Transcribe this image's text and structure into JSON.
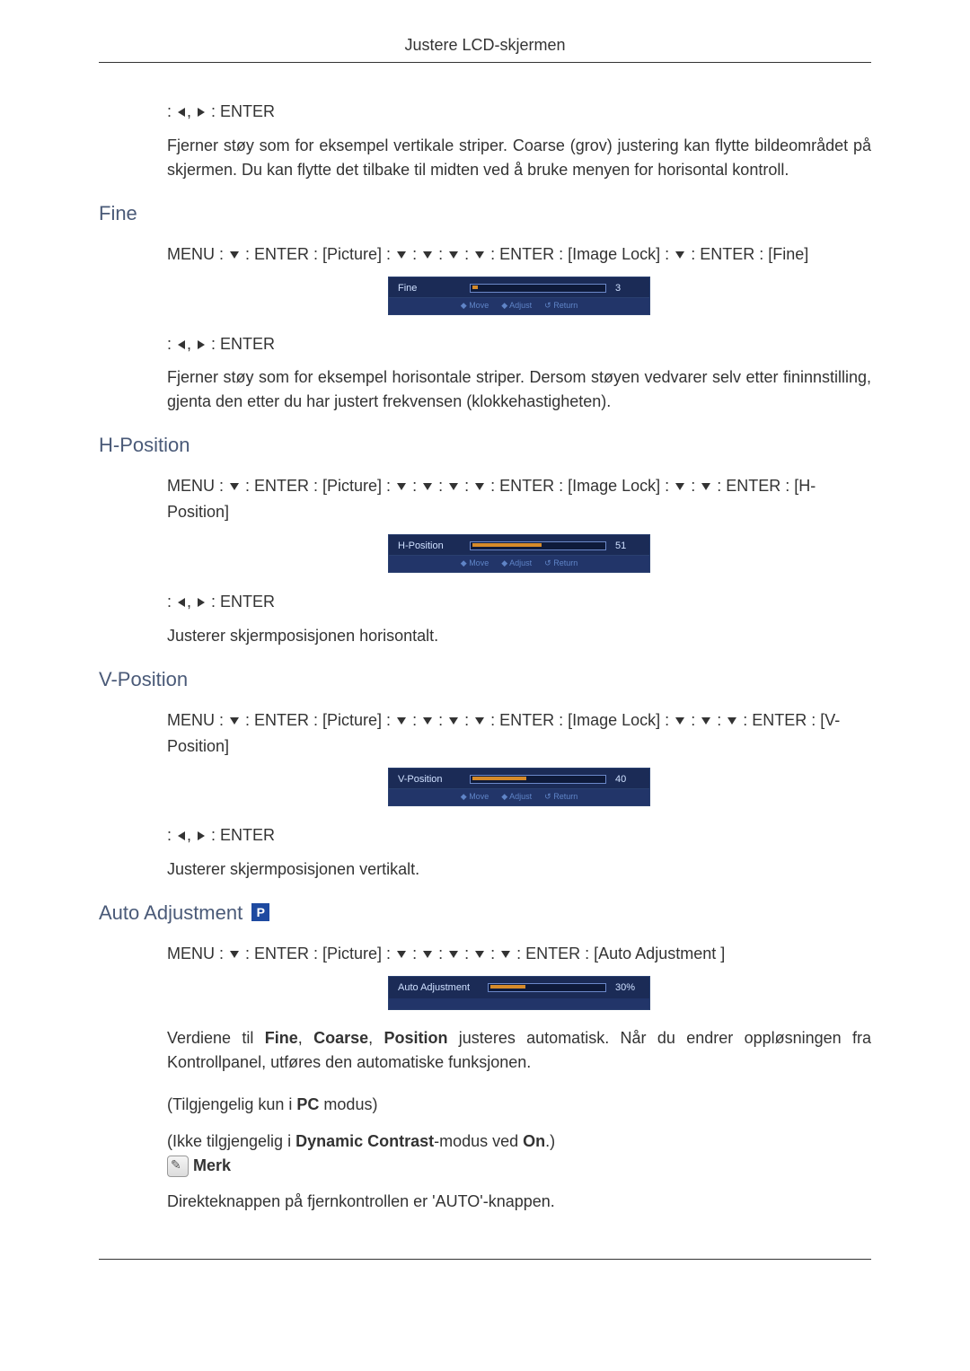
{
  "header": {
    "title": "Justere LCD-skjermen"
  },
  "top": {
    "nav_b": " : ENTER",
    "desc": "Fjerner støy som for eksempel vertikale striper. Coarse (grov) justering kan flytte bildeområdet på skjermen. Du kan flytte det tilbake til midten ved å bruke menyen for horisontal kontroll."
  },
  "fine": {
    "title": "Fine",
    "path1_a": "MENU  :  ",
    "path1_b": "  :  ENTER  :  [Picture]  :  ",
    "path1_c": "  :  ",
    "path1_d": "  :  ",
    "path1_e": "  :  ",
    "path1_f": "  :  ENTER  :  [Image Lock]  :  ",
    "path1_g": "  :  ENTER  : [Fine]",
    "osd_label": "Fine",
    "osd_value": "3",
    "hint_move": "◆ Move",
    "hint_adjust": "◆ Adjust",
    "hint_return": "↺ Return",
    "nav_b": " : ENTER",
    "desc": "Fjerner støy som for eksempel horisontale striper. Dersom støyen vedvarer selv etter fininnstilling, gjenta den etter du har justert frekvensen (klokkehastigheten)."
  },
  "hpos": {
    "title": "H-Position",
    "path1_a": "MENU  :  ",
    "path1_b": "  :  ENTER  :  [Picture]  :  ",
    "path1_c": "  :  ",
    "path1_d": "  :  ",
    "path1_e": "  :  ",
    "path1_f": "  :  ENTER  :  [Image Lock]  :  ",
    "path1_g": "  :  ",
    "path1_h": " :  ENTER  : [H-Position]",
    "osd_label": "H-Position",
    "osd_value": "51",
    "nav_b": " : ENTER",
    "desc": "Justerer skjermposisjonen horisontalt."
  },
  "vpos": {
    "title": "V-Position",
    "path1_a": "MENU  :  ",
    "path1_b": "  :  ENTER  :  [Picture]  :  ",
    "path1_c": "  :  ",
    "path1_d": "  :  ",
    "path1_e": "  :  ",
    "path1_f": "  :  ENTER  :  [Image Lock]  :  ",
    "path1_g": "  :  ",
    "path1_h": " :  ",
    "path1_i": "  : ENTER  : [V-Position]",
    "osd_label": "V-Position",
    "osd_value": "40",
    "nav_b": " : ENTER",
    "desc": "Justerer skjermposisjonen vertikalt."
  },
  "auto": {
    "title": "Auto Adjustment",
    "badge": "P",
    "path1_a": "MENU  :  ",
    "path1_b": "  : ENTER  : [Picture]  :     ",
    "path1_c": "  :  ",
    "path1_d": "  :  ",
    "path1_e": "  :  ",
    "path1_f": "  :  ",
    "path1_g": "  : ENTER  : [Auto Adjustment ]",
    "osd_label": "Auto Adjustment",
    "osd_value": "30%",
    "desc1a": "Verdiene til ",
    "desc1b": "Fine",
    "desc1c": ", ",
    "desc1d": "Coarse",
    "desc1e": ", ",
    "desc1f": "Position",
    "desc1g": " justeres automatisk. Når du endrer oppløsningen fra Kontrollpanel, utføres den automatiske funksjonen.",
    "desc2a": "(Tilgjengelig kun i ",
    "desc2b": "PC",
    "desc2c": " modus)",
    "desc3a": "(Ikke tilgjengelig i ",
    "desc3b": "Dynamic Contrast",
    "desc3c": "-modus ved ",
    "desc3d": "On",
    "desc3e": ".)",
    "merk": " Merk",
    "desc4": "Direkteknappen på fjernkontrollen er 'AUTO'-knappen."
  }
}
